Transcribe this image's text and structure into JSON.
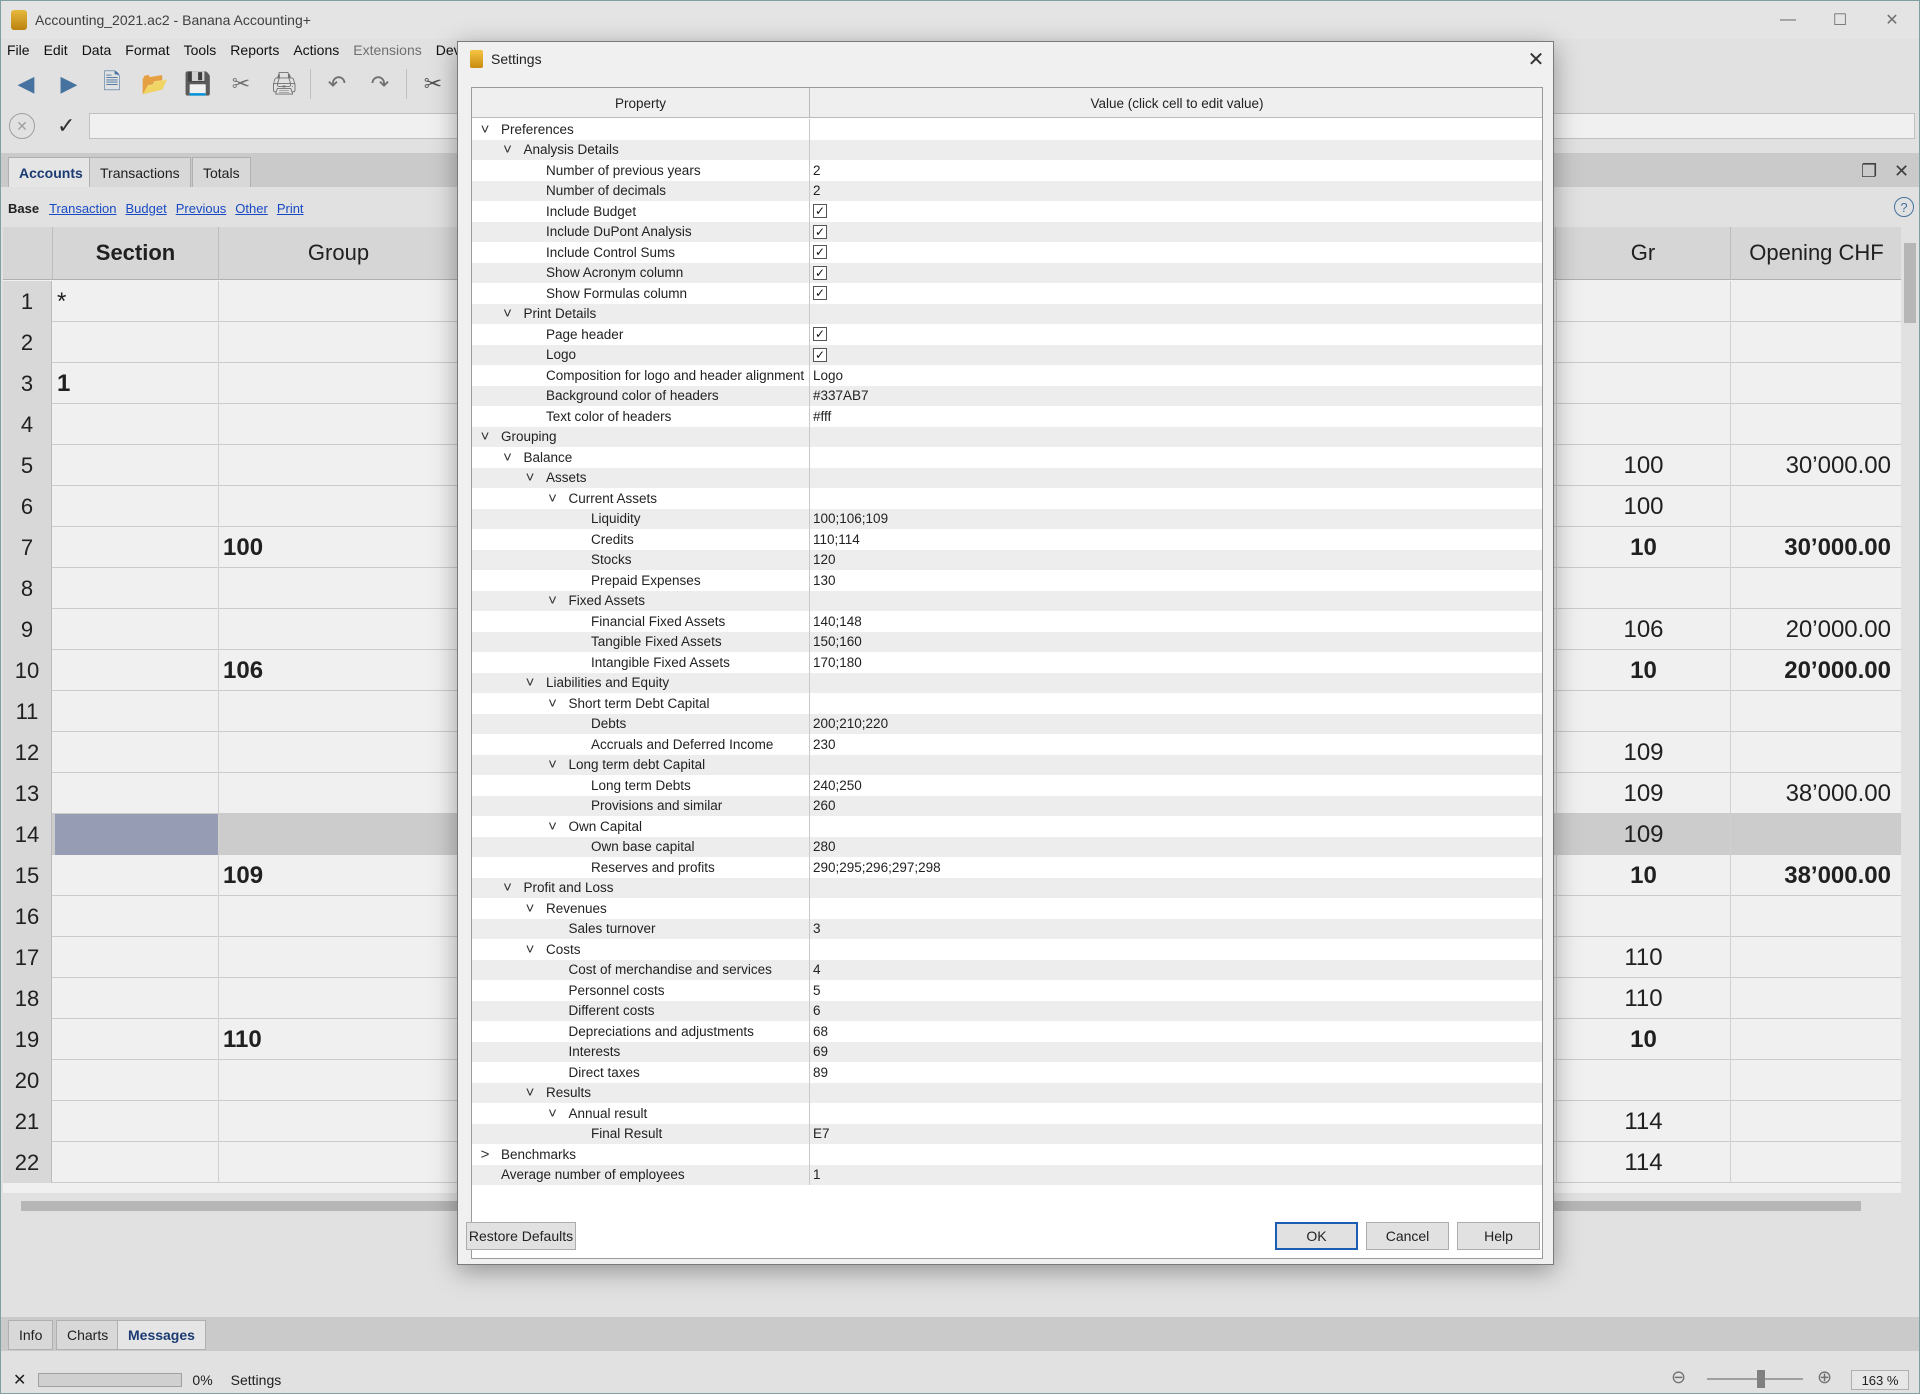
{
  "window": {
    "title": "Accounting_2021.ac2 - Banana Accounting+",
    "controls": [
      "—",
      "☐",
      "✕"
    ]
  },
  "menu": [
    "File",
    "Edit",
    "Data",
    "Format",
    "Tools",
    "Reports",
    "Actions",
    "Extensions",
    "Develop"
  ],
  "doc_tabs": [
    "Accounts",
    "Transactions",
    "Totals"
  ],
  "views": {
    "current": "Base",
    "links": [
      "Transaction",
      "Budget",
      "Previous",
      "Other",
      "Print"
    ]
  },
  "grid": {
    "headers": {
      "section": "Section",
      "group": "Group",
      "gr": "Gr",
      "opening": "Opening CHF"
    },
    "rows": [
      {
        "n": "1",
        "section": "*",
        "group": "",
        "gr": "",
        "opening": ""
      },
      {
        "n": "2",
        "section": "",
        "group": "",
        "gr": "",
        "opening": ""
      },
      {
        "n": "3",
        "section": "1",
        "group": "",
        "gr": "",
        "opening": ""
      },
      {
        "n": "4",
        "section": "",
        "group": "",
        "gr": "",
        "opening": ""
      },
      {
        "n": "5",
        "section": "",
        "group": "",
        "gr": "100",
        "opening": "30’000.00"
      },
      {
        "n": "6",
        "section": "",
        "group": "",
        "gr": "100",
        "opening": ""
      },
      {
        "n": "7",
        "section": "",
        "group": "100",
        "gr": "10",
        "opening": "30’000.00"
      },
      {
        "n": "8",
        "section": "",
        "group": "",
        "gr": "",
        "opening": ""
      },
      {
        "n": "9",
        "section": "",
        "group": "",
        "gr": "106",
        "opening": "20’000.00"
      },
      {
        "n": "10",
        "section": "",
        "group": "106",
        "gr": "10",
        "opening": "20’000.00"
      },
      {
        "n": "11",
        "section": "",
        "group": "",
        "gr": "",
        "opening": ""
      },
      {
        "n": "12",
        "section": "",
        "group": "",
        "gr": "109",
        "opening": ""
      },
      {
        "n": "13",
        "section": "",
        "group": "",
        "gr": "109",
        "opening": "38’000.00"
      },
      {
        "n": "14",
        "section": "",
        "group": "",
        "gr": "109",
        "opening": ""
      },
      {
        "n": "15",
        "section": "",
        "group": "109",
        "gr": "10",
        "opening": "38’000.00"
      },
      {
        "n": "16",
        "section": "",
        "group": "",
        "gr": "",
        "opening": ""
      },
      {
        "n": "17",
        "section": "",
        "group": "",
        "gr": "110",
        "opening": ""
      },
      {
        "n": "18",
        "section": "",
        "group": "",
        "gr": "110",
        "opening": ""
      },
      {
        "n": "19",
        "section": "",
        "group": "110",
        "gr": "10",
        "opening": ""
      },
      {
        "n": "20",
        "section": "",
        "group": "",
        "gr": "",
        "opening": ""
      },
      {
        "n": "21",
        "section": "",
        "group": "",
        "gr": "114",
        "opening": ""
      },
      {
        "n": "22",
        "section": "",
        "group": "",
        "gr": "114",
        "opening": ""
      }
    ]
  },
  "bottom_tabs": [
    "Info",
    "Charts",
    "Messages"
  ],
  "status": {
    "progress": "0%",
    "text": "Settings",
    "zoom": "163 %"
  },
  "dialog": {
    "title": "Settings",
    "columns": {
      "property": "Property",
      "value": "Value (click cell to edit value)"
    },
    "rows": [
      {
        "level": 0,
        "arrow": "down",
        "label": "Preferences",
        "value": ""
      },
      {
        "level": 1,
        "arrow": "down",
        "label": "Analysis Details",
        "value": ""
      },
      {
        "level": 2,
        "label": "Number of previous years",
        "value": "2"
      },
      {
        "level": 2,
        "label": "Number of decimals",
        "value": "2"
      },
      {
        "level": 2,
        "label": "Include Budget",
        "check": true
      },
      {
        "level": 2,
        "label": "Include DuPont Analysis",
        "check": true
      },
      {
        "level": 2,
        "label": "Include Control Sums",
        "check": true
      },
      {
        "level": 2,
        "label": "Show Acronym column",
        "check": true
      },
      {
        "level": 2,
        "label": "Show Formulas column",
        "check": true
      },
      {
        "level": 1,
        "arrow": "down",
        "label": "Print Details",
        "value": ""
      },
      {
        "level": 2,
        "label": "Page header",
        "check": true
      },
      {
        "level": 2,
        "label": "Logo",
        "check": true
      },
      {
        "level": 2,
        "label": "Composition for logo and header alignment",
        "value": "Logo"
      },
      {
        "level": 2,
        "label": "Background color of headers",
        "value": "#337AB7"
      },
      {
        "level": 2,
        "label": "Text color of headers",
        "value": "#fff"
      },
      {
        "level": 0,
        "arrow": "down",
        "label": "Grouping",
        "value": ""
      },
      {
        "level": 1,
        "arrow": "down",
        "label": "Balance",
        "value": ""
      },
      {
        "level": 2,
        "arrow": "down",
        "label": "Assets",
        "value": ""
      },
      {
        "level": 3,
        "arrow": "down",
        "label": "Current Assets",
        "value": ""
      },
      {
        "level": 4,
        "label": "Liquidity",
        "value": "100;106;109"
      },
      {
        "level": 4,
        "label": "Credits",
        "value": "110;114"
      },
      {
        "level": 4,
        "label": "Stocks",
        "value": "120"
      },
      {
        "level": 4,
        "label": "Prepaid Expenses",
        "value": "130"
      },
      {
        "level": 3,
        "arrow": "down",
        "label": "Fixed Assets",
        "value": ""
      },
      {
        "level": 4,
        "label": "Financial Fixed Assets",
        "value": "140;148"
      },
      {
        "level": 4,
        "label": "Tangible Fixed Assets",
        "value": "150;160"
      },
      {
        "level": 4,
        "label": "Intangible Fixed Assets",
        "value": "170;180"
      },
      {
        "level": 2,
        "arrow": "down",
        "label": "Liabilities and Equity",
        "value": ""
      },
      {
        "level": 3,
        "arrow": "down",
        "label": "Short term Debt Capital",
        "value": ""
      },
      {
        "level": 4,
        "label": "Debts",
        "value": "200;210;220"
      },
      {
        "level": 4,
        "label": "Accruals and Deferred Income",
        "value": "230"
      },
      {
        "level": 3,
        "arrow": "down",
        "label": "Long term debt Capital",
        "value": ""
      },
      {
        "level": 4,
        "label": "Long term Debts",
        "value": "240;250"
      },
      {
        "level": 4,
        "label": "Provisions and similar",
        "value": "260"
      },
      {
        "level": 3,
        "arrow": "down",
        "label": "Own Capital",
        "value": ""
      },
      {
        "level": 4,
        "label": "Own base capital",
        "value": "280"
      },
      {
        "level": 4,
        "label": "Reserves and profits",
        "value": "290;295;296;297;298"
      },
      {
        "level": 1,
        "arrow": "down",
        "label": "Profit and Loss",
        "value": ""
      },
      {
        "level": 2,
        "arrow": "down",
        "label": "Revenues",
        "value": ""
      },
      {
        "level": 3,
        "label": "Sales turnover",
        "value": "3"
      },
      {
        "level": 2,
        "arrow": "down",
        "label": "Costs",
        "value": ""
      },
      {
        "level": 3,
        "label": "Cost of merchandise and services",
        "value": "4"
      },
      {
        "level": 3,
        "label": "Personnel costs",
        "value": "5"
      },
      {
        "level": 3,
        "label": "Different costs",
        "value": "6"
      },
      {
        "level": 3,
        "label": "Depreciations and adjustments",
        "value": "68"
      },
      {
        "level": 3,
        "label": "Interests",
        "value": "69"
      },
      {
        "level": 3,
        "label": "Direct taxes",
        "value": "89"
      },
      {
        "level": 2,
        "arrow": "down",
        "label": "Results",
        "value": ""
      },
      {
        "level": 3,
        "arrow": "down",
        "label": "Annual result",
        "value": ""
      },
      {
        "level": 4,
        "label": "Final Result",
        "value": "E7"
      },
      {
        "level": 0,
        "arrow": "right",
        "label": "Benchmarks",
        "value": ""
      },
      {
        "level": 0,
        "label": "Average number of employees",
        "value": "1"
      }
    ],
    "buttons": {
      "restore": "Restore Defaults",
      "ok": "OK",
      "cancel": "Cancel",
      "help": "Help"
    }
  }
}
